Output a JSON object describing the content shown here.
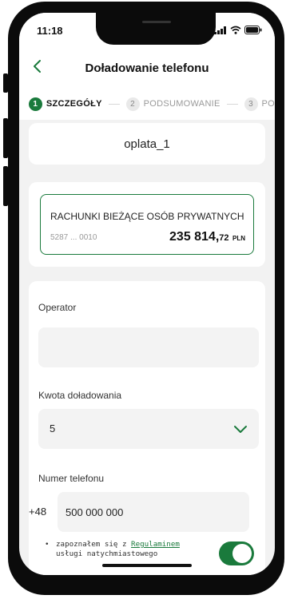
{
  "status_bar": {
    "time": "11:18",
    "icons": [
      "signal-icon",
      "wifi-icon",
      "battery-icon"
    ]
  },
  "header": {
    "title": "Doładowanie telefonu",
    "back_icon": "chevron-left-icon"
  },
  "stepper": {
    "steps": [
      {
        "number": "1",
        "label": "SZCZEGÓŁY",
        "active": true
      },
      {
        "number": "2",
        "label": "PODSUMOWANIE",
        "active": false
      },
      {
        "number": "3",
        "label": "PO",
        "active": false
      }
    ]
  },
  "recipient_card": {
    "name": "oplata_1"
  },
  "account": {
    "name": "RACHUNKI BIEŻĄCE OSÓB PRYWATNYCH",
    "number": "5287 ... 0010",
    "balance_int": "235 814,",
    "balance_dec": "72",
    "currency": "PLN"
  },
  "form": {
    "operator": {
      "label": "Operator",
      "value": ""
    },
    "amount": {
      "label": "Kwota doładowania",
      "value": "5"
    },
    "phone": {
      "label": "Numer telefonu",
      "prefix": "+48",
      "value": "500 000 000"
    },
    "consent": {
      "bullet": "•",
      "text_before": "zapoznałem się z ",
      "link": "Regulaminem",
      "text_after": "usługi natychmiastowego",
      "toggle_on": true
    }
  },
  "colors": {
    "accent": "#1a7a3c",
    "background": "#f2f2f2",
    "card": "#ffffff"
  }
}
